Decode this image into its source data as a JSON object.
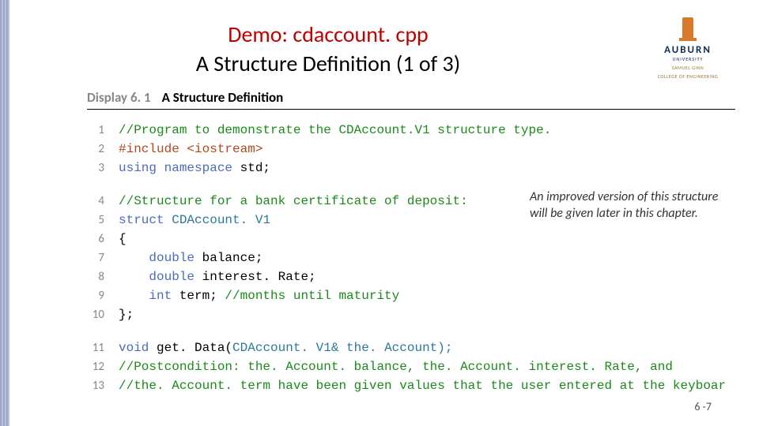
{
  "title_line1": "Demo: cdaccount. cpp",
  "title_line2": "A Structure Definition (1 of 3)",
  "logo": {
    "name": "AUBURN",
    "sub": "UNIVERSITY",
    "eng1": "SAMUEL GINN",
    "eng2": "COLLEGE OF ENGINEERING"
  },
  "display_label": "Display 6. 1",
  "display_title": "A Structure Definition",
  "callout": "An improved version of this structure will be given later in this chapter.",
  "pagenum": "6 -7",
  "code": [
    {
      "ln": "1",
      "text1": "//Program to demonstrate the CDAccount.V1 structure type.",
      "cls1": "c-comment"
    },
    {
      "ln": "2",
      "text1": "#include ",
      "cls1": "c-pre",
      "text2": "<iostream>",
      "cls2": "c-pre"
    },
    {
      "ln": "3",
      "text1": "using namespace ",
      "cls1": "c-key",
      "text2": "std;",
      "cls2": ""
    },
    {
      "spacer": true
    },
    {
      "ln": "4",
      "text1": "//Structure for a bank certificate of deposit:",
      "cls1": "c-comment"
    },
    {
      "ln": "5",
      "text1": "struct ",
      "cls1": "c-key",
      "text2": "CDAccount. V1",
      "cls2": "c-ident"
    },
    {
      "ln": "6",
      "text1": "{",
      "cls1": ""
    },
    {
      "ln": "7",
      "text1": "    double ",
      "cls1": "c-type",
      "text2": "balance;",
      "cls2": ""
    },
    {
      "ln": "8",
      "text1": "    double ",
      "cls1": "c-type",
      "text2": "interest. Rate;",
      "cls2": ""
    },
    {
      "ln": "9",
      "text1": "    int ",
      "cls1": "c-type",
      "text2": "term; ",
      "cls2": "",
      "text3": "//months until maturity",
      "cls3": "c-comment"
    },
    {
      "ln": "10",
      "text1": "};",
      "cls1": ""
    },
    {
      "spacer": true
    },
    {
      "ln": "11",
      "text1": "void ",
      "cls1": "c-type",
      "text2": "get. Data(",
      "cls2": "",
      "text3": "CDAccount. V1& the. Account);",
      "cls3": "c-ident"
    },
    {
      "ln": "12",
      "text1": "//Postcondition: the. Account. balance, the. Account. interest. Rate, and",
      "cls1": "c-comment"
    },
    {
      "ln": "13",
      "text1": "//the. Account. term have been given values that the user entered at the keyboar",
      "cls1": "c-comment"
    }
  ]
}
